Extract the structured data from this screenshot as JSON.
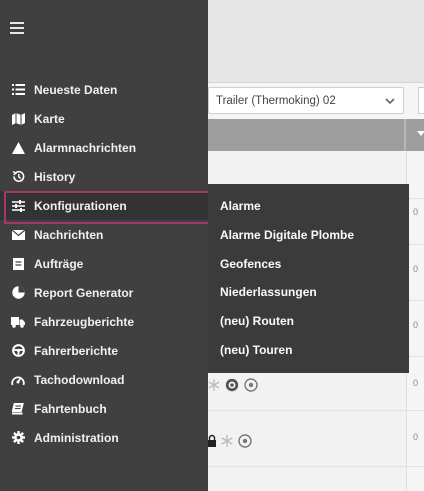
{
  "filter": {
    "vehicle_select_value": "Trailer (Thermoking) 02"
  },
  "rows": {
    "number_prefix": "0"
  },
  "sidebar": {
    "items": [
      {
        "label": "Neueste Daten",
        "icon": "list-icon"
      },
      {
        "label": "Karte",
        "icon": "map-icon"
      },
      {
        "label": "Alarmnachrichten",
        "icon": "warning-icon"
      },
      {
        "label": "History",
        "icon": "history-icon"
      },
      {
        "label": "Konfigurationen",
        "icon": "sliders-icon",
        "active": true
      },
      {
        "label": "Nachrichten",
        "icon": "envelope-icon"
      },
      {
        "label": "Aufträge",
        "icon": "clipboard-icon"
      },
      {
        "label": "Report Generator",
        "icon": "pie-chart-icon"
      },
      {
        "label": "Fahrzeugberichte",
        "icon": "truck-icon"
      },
      {
        "label": "Fahrerberichte",
        "icon": "steering-wheel-icon"
      },
      {
        "label": "Tachodownload",
        "icon": "tachometer-icon"
      },
      {
        "label": "Fahrtenbuch",
        "icon": "logbook-icon"
      },
      {
        "label": "Administration",
        "icon": "gear-icon"
      }
    ]
  },
  "submenu": {
    "items": [
      {
        "label": "Alarme"
      },
      {
        "label": "Alarme Digitale Plombe"
      },
      {
        "label": "Geofences"
      },
      {
        "label": "Niederlassungen"
      },
      {
        "label": "(neu) Routen"
      },
      {
        "label": "(neu) Touren"
      }
    ]
  },
  "colors": {
    "sidebar_bg": "#404040",
    "submenu_bg": "#3b3b3b",
    "active_outline": "#a2376c",
    "header_bar": "#9e9e9e"
  }
}
